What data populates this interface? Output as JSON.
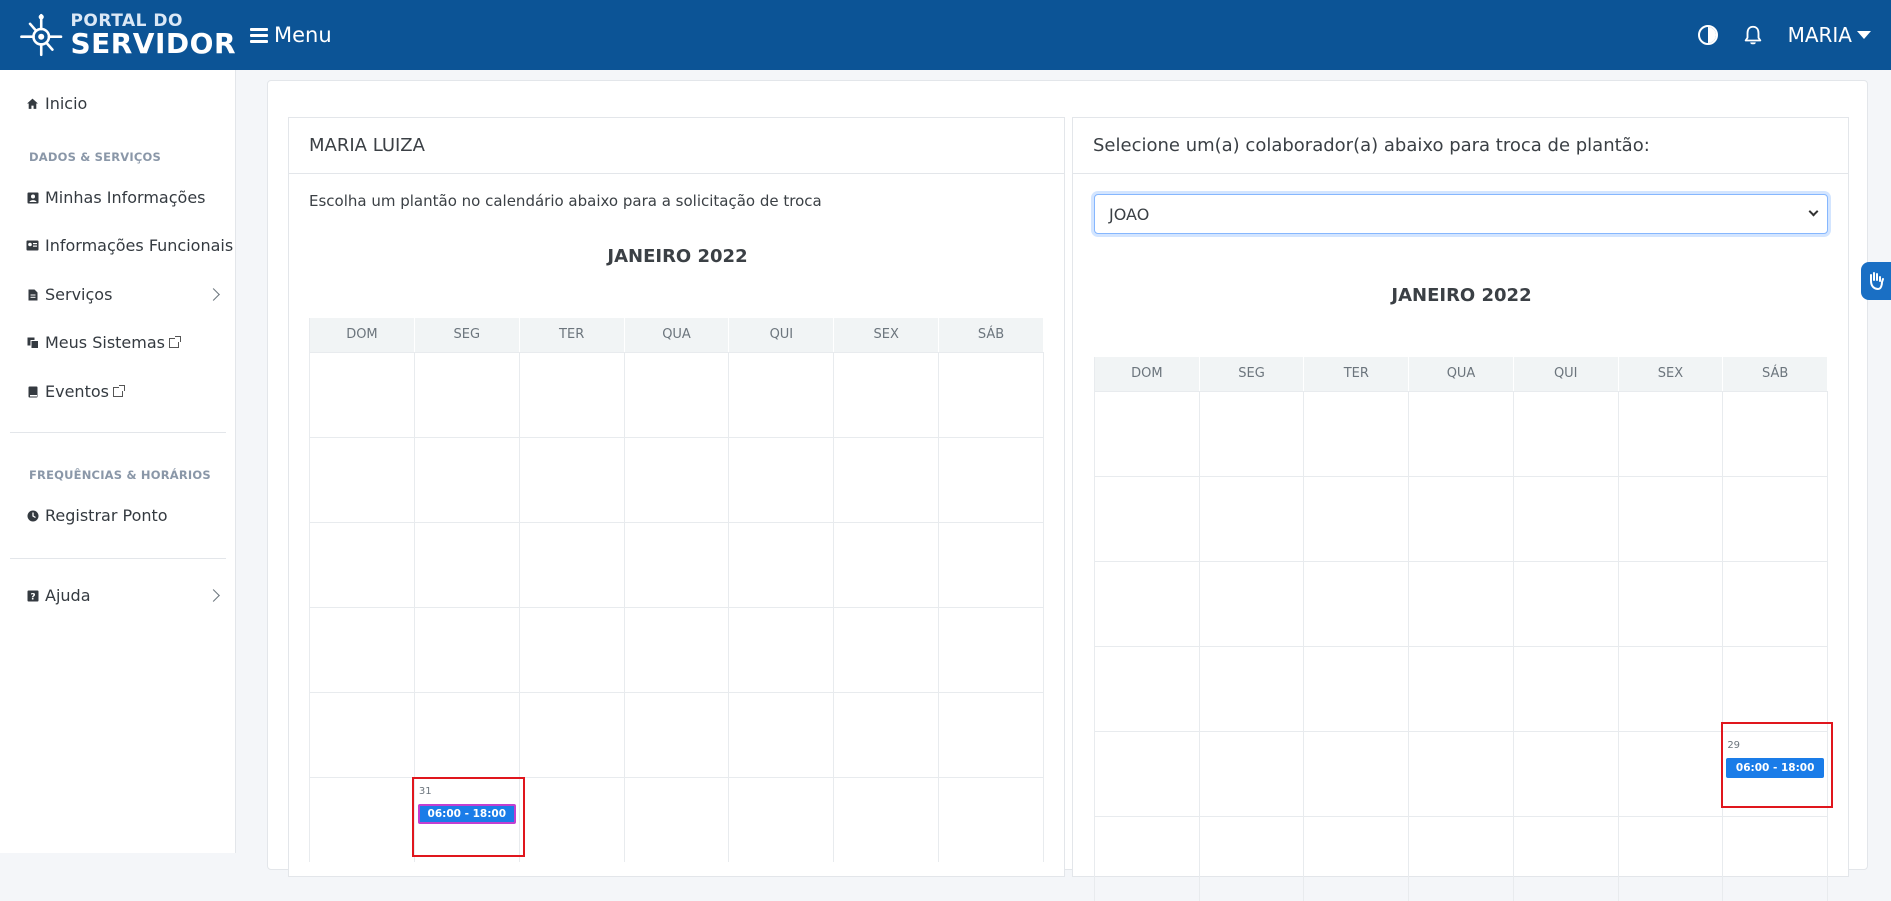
{
  "header": {
    "logo_line1": "PORTAL DO",
    "logo_line2": "SERVIDOR",
    "menu_label": "Menu",
    "user_name": "MARIA"
  },
  "sidebar": {
    "home": "Inicio",
    "section_data": "DADOS & SERVIÇOS",
    "items": [
      {
        "label": "Minhas Informações",
        "icon": "id-card-icon"
      },
      {
        "label": "Informações Funcionais",
        "icon": "badge-icon"
      },
      {
        "label": "Serviços",
        "icon": "file-icon"
      },
      {
        "label": "Meus Sistemas",
        "icon": "copy-icon"
      },
      {
        "label": "Eventos",
        "icon": "book-icon"
      }
    ],
    "section_freq": "FREQUÊNCIAS & HORÁRIOS",
    "register": "Registrar Ponto",
    "help": "Ajuda"
  },
  "left_panel": {
    "title": "MARIA LUIZA",
    "instruction": "Escolha um plantão no calendário abaixo para a solicitação de troca",
    "calendar_title": "JANEIRO 2022",
    "weekdays": [
      "DOM",
      "SEG",
      "TER",
      "QUA",
      "QUI",
      "SEX",
      "SÁB"
    ],
    "event_day": "31",
    "event_time": "06:00 - 18:00"
  },
  "right_panel": {
    "title": "Selecione um(a) colaborador(a) abaixo para troca de plantão:",
    "selected_colleague": "JOAO",
    "calendar_title": "JANEIRO 2022",
    "weekdays": [
      "DOM",
      "SEG",
      "TER",
      "QUA",
      "QUI",
      "SEX",
      "SÁB"
    ],
    "event_day": "29",
    "event_time": "06:00 - 18:00"
  },
  "colors": {
    "header_bg": "#0c5496",
    "event_bg": "#1a7ce8",
    "highlight": "#e0161d"
  }
}
